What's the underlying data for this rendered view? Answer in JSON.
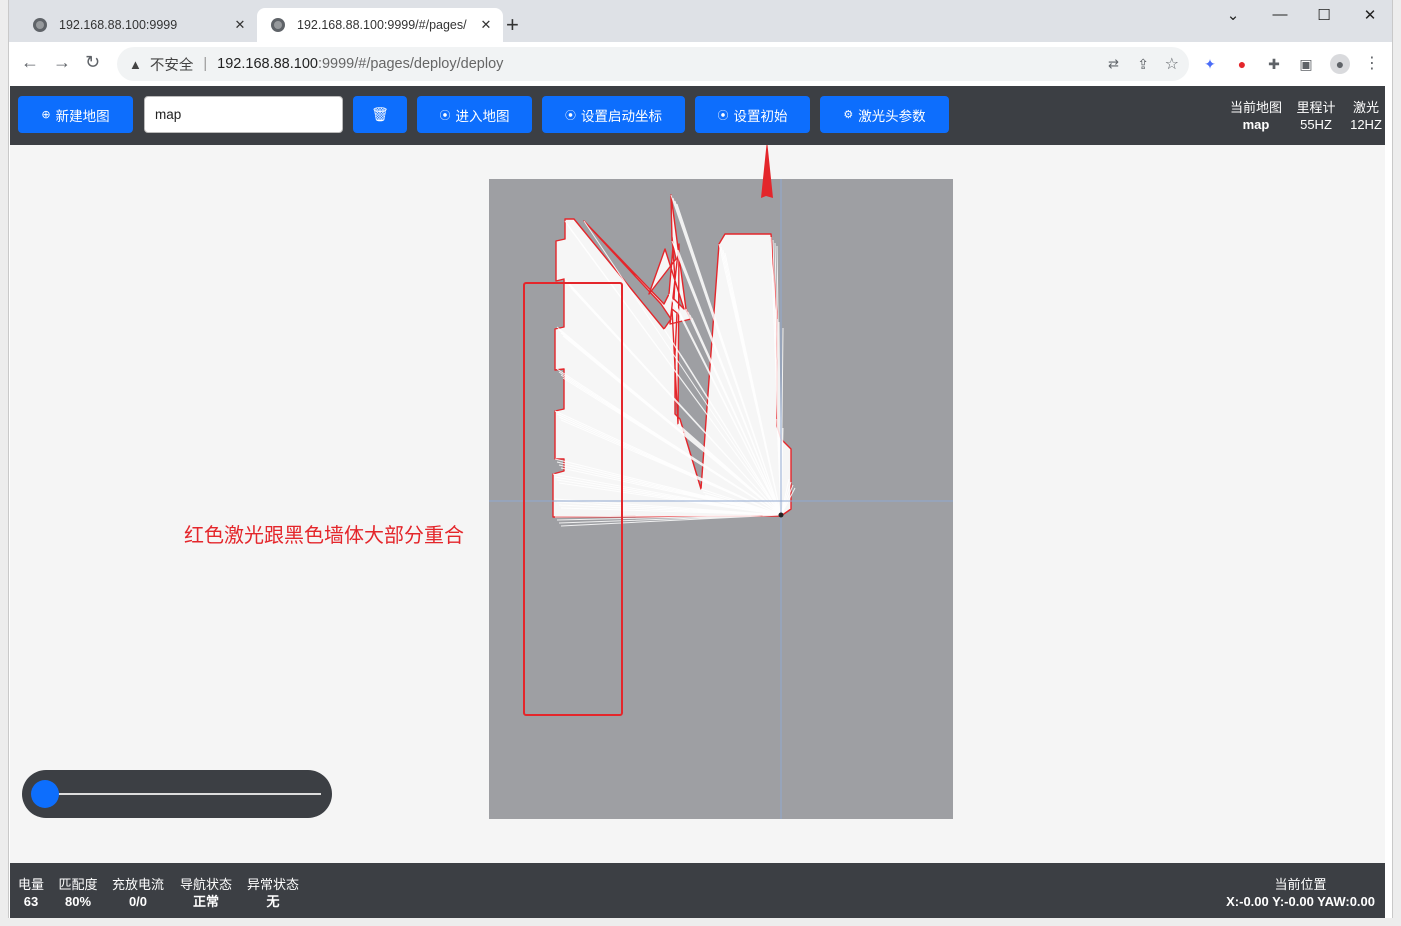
{
  "browser": {
    "tabs": [
      {
        "title": "192.168.88.100:9999",
        "active": false
      },
      {
        "title": "192.168.88.100:9999/#/pages/",
        "active": true
      }
    ],
    "address": {
      "security": "不安全",
      "host": "192.168.88.100",
      "path": ":9999/#/pages/deploy/deploy"
    }
  },
  "toolbar": {
    "new_map_label": "新建地图",
    "map_name_value": "map",
    "enter_map_label": "进入地图",
    "set_start_coord_label": "设置启动坐标",
    "set_initial_label": "设置初始",
    "laser_params_label": "激光头参数"
  },
  "status_top": {
    "current_map": {
      "label": "当前地图",
      "value": "map"
    },
    "odometer": {
      "label": "里程计",
      "value": "55HZ"
    },
    "laser": {
      "label": "激光",
      "value": "12HZ"
    }
  },
  "annotation": {
    "note": "红色激光跟黑色墙体大部分重合",
    "color": "#e4262b"
  },
  "status_bottom": {
    "items": [
      {
        "label": "电量",
        "value": "63"
      },
      {
        "label": "匹配度",
        "value": "80%"
      },
      {
        "label": "充放电流",
        "value": "0/0"
      },
      {
        "label": "导航状态",
        "value": "正常"
      },
      {
        "label": "异常状态",
        "value": "无"
      }
    ],
    "position": {
      "label": "当前位置",
      "value": "X:-0.00 Y:-0.00 YAW:0.00"
    }
  },
  "colors": {
    "header_bg": "#3c3f44",
    "button_blue": "#0d6efd",
    "map_gray": "#9e9fa3",
    "laser_red": "#e4262b"
  }
}
